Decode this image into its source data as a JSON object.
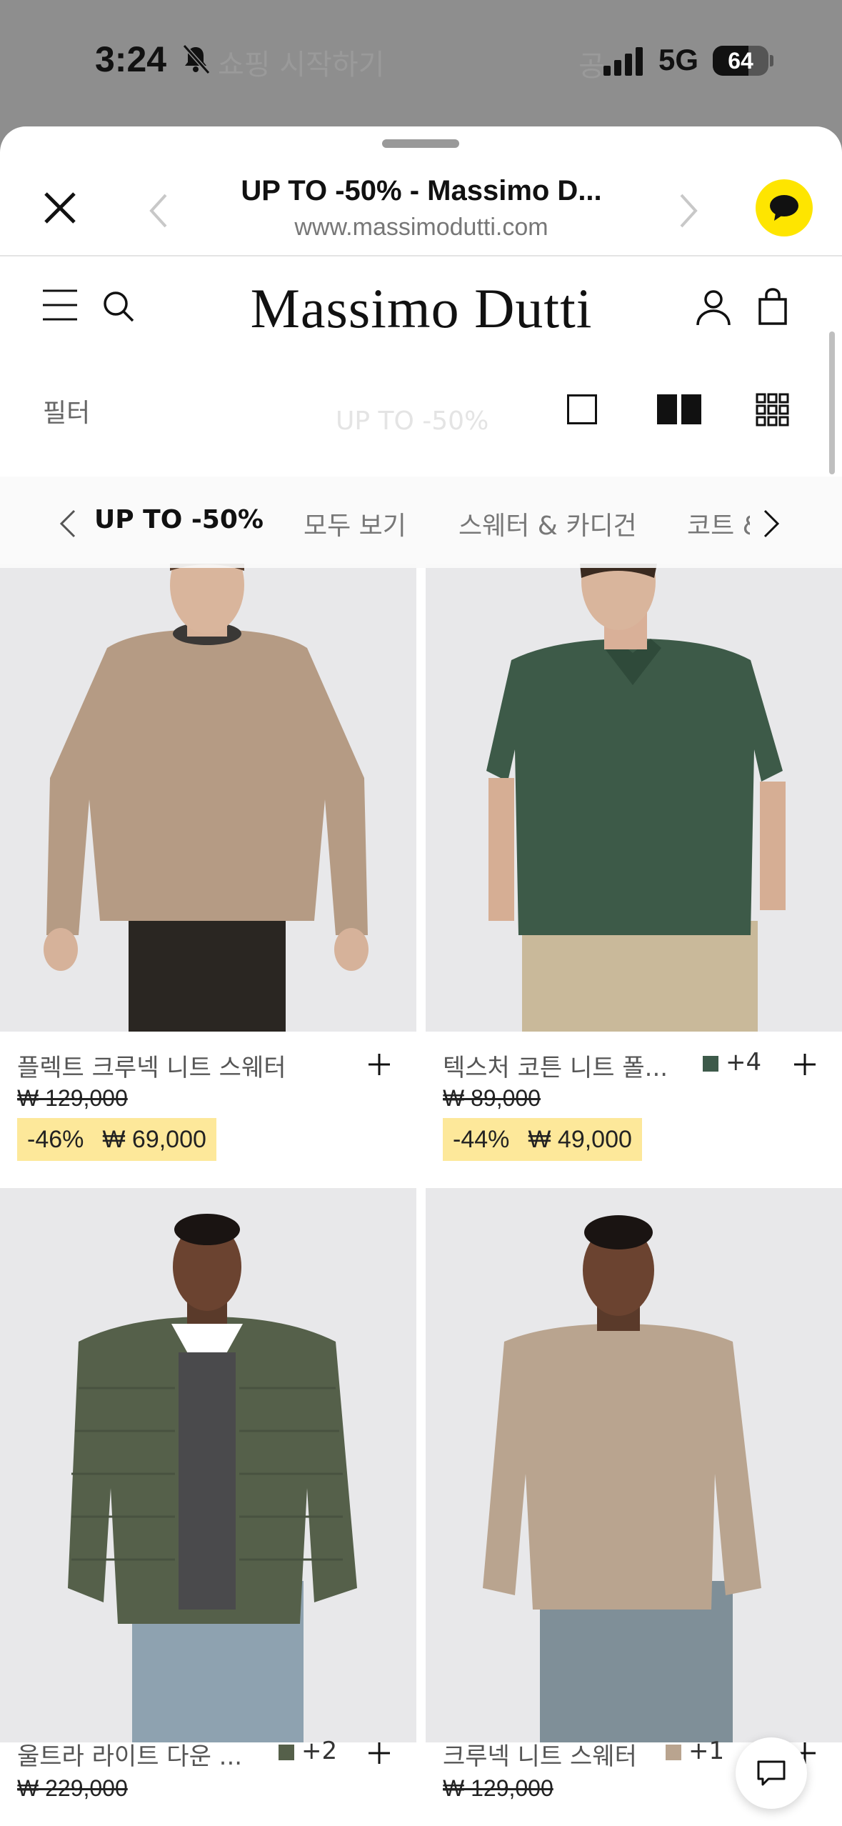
{
  "status_bar": {
    "time": "3:24",
    "ghost_title": "쇼핑 시작하기",
    "ghost_right": "공",
    "network": "5G",
    "battery": "64",
    "battery_level": 0.64
  },
  "browser": {
    "title": "UP TO -50% - Massimo D...",
    "url": "www.massimodutti.com"
  },
  "site": {
    "logo": "Massimo Dutti",
    "filter_label": "필터",
    "faded_title": "UP TO -50%"
  },
  "categories": [
    {
      "label": "UP TO -50%",
      "active": true
    },
    {
      "label": "모두 보기",
      "active": false
    },
    {
      "label": "스웨터 & 카디건",
      "active": false
    },
    {
      "label": "코트 &",
      "active": false
    }
  ],
  "products": [
    {
      "name": "플렉트 크루넥 니트 스웨터",
      "old_price": "₩ 129,000",
      "discount": "-46%",
      "sale_price": "₩ 69,000",
      "swatch": "",
      "swatch_color": "",
      "image": "beige-crewneck-sweater"
    },
    {
      "name": "텍스처 코튼 니트 폴...",
      "old_price": "₩ 89,000",
      "discount": "-44%",
      "sale_price": "₩ 49,000",
      "swatch": "+4",
      "swatch_color": "#3d5a4a",
      "image": "green-knit-polo"
    },
    {
      "name": "울트라 라이트 다운 ...",
      "old_price": "₩ 229,000",
      "discount": "",
      "sale_price": "",
      "swatch": "+2",
      "swatch_color": "#55604a",
      "image": "olive-down-jacket"
    },
    {
      "name": "크루넥 니트 스웨터",
      "old_price": "₩ 129,000",
      "discount": "",
      "sale_price": "",
      "swatch": "+1",
      "swatch_color": "#b9a48f",
      "image": "beige-knit-sweater"
    }
  ],
  "colors": {
    "kakao_yellow": "#fee500",
    "sale_highlight": "#fde89a"
  }
}
